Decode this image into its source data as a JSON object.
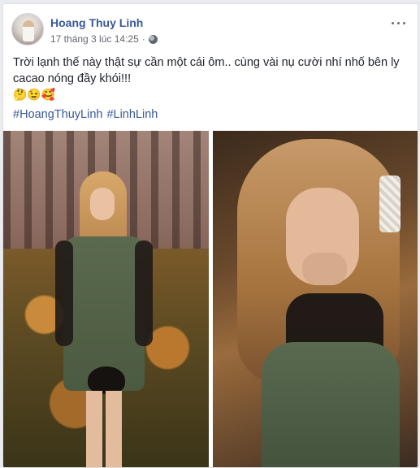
{
  "post": {
    "author_name": "Hoang Thuy Linh",
    "timestamp": "17 tháng 3 lúc 14:25",
    "privacy_icon": "globe-icon",
    "more_icon": "ellipsis-icon",
    "caption": "Trời lạnh thế này thật sự cần một cái ôm.. cùng vài nụ cười nhí nhố bên ly cacao nóng đầy khói!!!",
    "emojis": "🤔😉🥰",
    "hashtags": [
      "#HoangThuyLinh",
      "#LinhLinh"
    ]
  }
}
